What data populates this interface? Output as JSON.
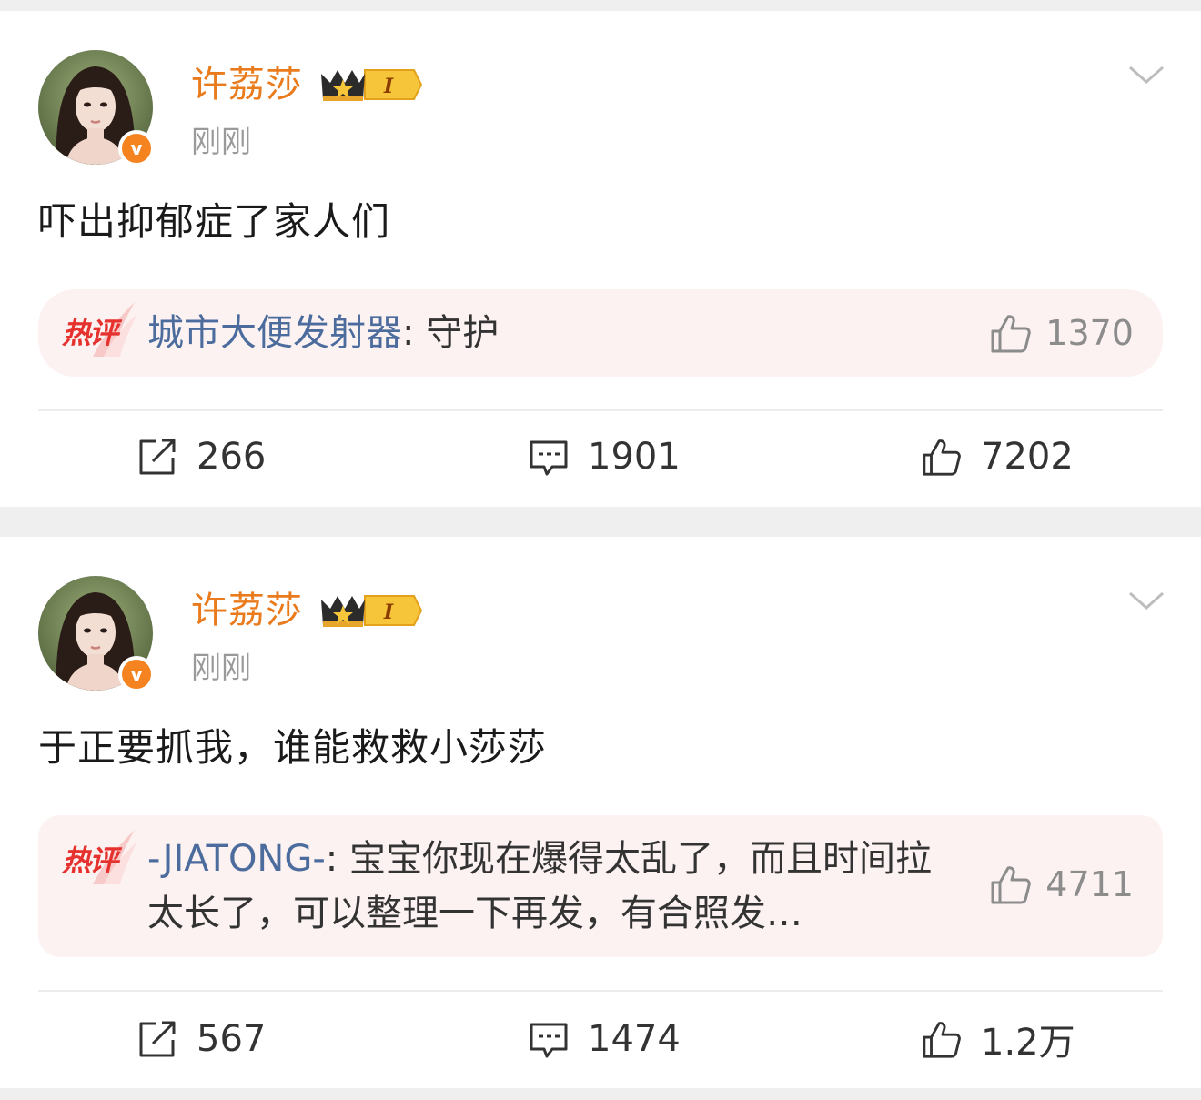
{
  "posts": [
    {
      "author": "许荔莎",
      "vip_level": "I",
      "verified_mark": "v",
      "timestamp": "刚刚",
      "text": "吓出抑郁症了家人们",
      "hot_comment": {
        "tag": "热评",
        "commenter": "城市大便发射器",
        "separator": ": ",
        "text": "守护",
        "likes": "1370"
      },
      "actions": {
        "reposts": "266",
        "comments": "1901",
        "likes": "7202"
      }
    },
    {
      "author": "许荔莎",
      "vip_level": "I",
      "verified_mark": "v",
      "timestamp": "刚刚",
      "text": "于正要抓我，谁能救救小莎莎",
      "hot_comment": {
        "tag": "热评",
        "commenter": "-JIATONG-",
        "separator": ": ",
        "text": "宝宝你现在爆得太乱了，而且时间拉太长了，可以整理一下再发，有合照发…",
        "likes": "4711"
      },
      "actions": {
        "reposts": "567",
        "comments": "1474",
        "likes": "1.2万"
      }
    }
  ],
  "colors": {
    "username": "#e97b1c",
    "commenter": "#4b6c9c",
    "hot_tag": "#e6322e",
    "hot_bg": "#fdf2f2",
    "verified_badge": "#f5831f",
    "muted": "#9a9a9a",
    "feed_bg": "#efefef"
  },
  "icons": {
    "avatar": "avatar-photo",
    "verified": "verified-v-icon",
    "vip": "vip-crown-badge-icon",
    "more": "chevron-down-icon",
    "repost": "repost-icon",
    "comment": "comment-icon",
    "like": "thumbs-up-icon"
  }
}
